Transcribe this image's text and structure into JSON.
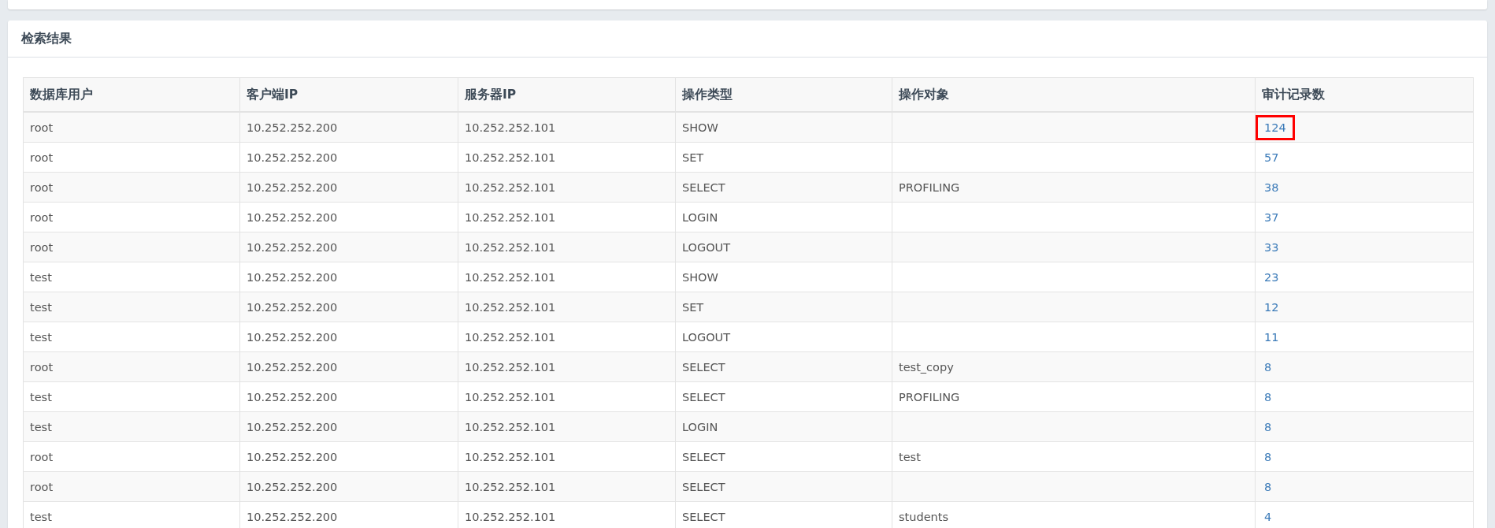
{
  "panel": {
    "title": "检索结果"
  },
  "table": {
    "columns": [
      "数据库用户",
      "客户端IP",
      "服务器IP",
      "操作类型",
      "操作对象",
      "审计记录数"
    ],
    "rows": [
      {
        "user": "root",
        "client_ip": "10.252.252.200",
        "server_ip": "10.252.252.101",
        "operation": "SHOW",
        "object": "",
        "count": "124",
        "highlighted": true
      },
      {
        "user": "root",
        "client_ip": "10.252.252.200",
        "server_ip": "10.252.252.101",
        "operation": "SET",
        "object": "",
        "count": "57",
        "highlighted": false
      },
      {
        "user": "root",
        "client_ip": "10.252.252.200",
        "server_ip": "10.252.252.101",
        "operation": "SELECT",
        "object": "PROFILING",
        "count": "38",
        "highlighted": false
      },
      {
        "user": "root",
        "client_ip": "10.252.252.200",
        "server_ip": "10.252.252.101",
        "operation": "LOGIN",
        "object": "",
        "count": "37",
        "highlighted": false
      },
      {
        "user": "root",
        "client_ip": "10.252.252.200",
        "server_ip": "10.252.252.101",
        "operation": "LOGOUT",
        "object": "",
        "count": "33",
        "highlighted": false
      },
      {
        "user": "test",
        "client_ip": "10.252.252.200",
        "server_ip": "10.252.252.101",
        "operation": "SHOW",
        "object": "",
        "count": "23",
        "highlighted": false
      },
      {
        "user": "test",
        "client_ip": "10.252.252.200",
        "server_ip": "10.252.252.101",
        "operation": "SET",
        "object": "",
        "count": "12",
        "highlighted": false
      },
      {
        "user": "test",
        "client_ip": "10.252.252.200",
        "server_ip": "10.252.252.101",
        "operation": "LOGOUT",
        "object": "",
        "count": "11",
        "highlighted": false
      },
      {
        "user": "root",
        "client_ip": "10.252.252.200",
        "server_ip": "10.252.252.101",
        "operation": "SELECT",
        "object": "test_copy",
        "count": "8",
        "highlighted": false
      },
      {
        "user": "test",
        "client_ip": "10.252.252.200",
        "server_ip": "10.252.252.101",
        "operation": "SELECT",
        "object": "PROFILING",
        "count": "8",
        "highlighted": false
      },
      {
        "user": "test",
        "client_ip": "10.252.252.200",
        "server_ip": "10.252.252.101",
        "operation": "LOGIN",
        "object": "",
        "count": "8",
        "highlighted": false
      },
      {
        "user": "root",
        "client_ip": "10.252.252.200",
        "server_ip": "10.252.252.101",
        "operation": "SELECT",
        "object": "test",
        "count": "8",
        "highlighted": false
      },
      {
        "user": "root",
        "client_ip": "10.252.252.200",
        "server_ip": "10.252.252.101",
        "operation": "SELECT",
        "object": "",
        "count": "8",
        "highlighted": false
      },
      {
        "user": "test",
        "client_ip": "10.252.252.200",
        "server_ip": "10.252.252.101",
        "operation": "SELECT",
        "object": "students",
        "count": "4",
        "highlighted": false
      }
    ]
  }
}
